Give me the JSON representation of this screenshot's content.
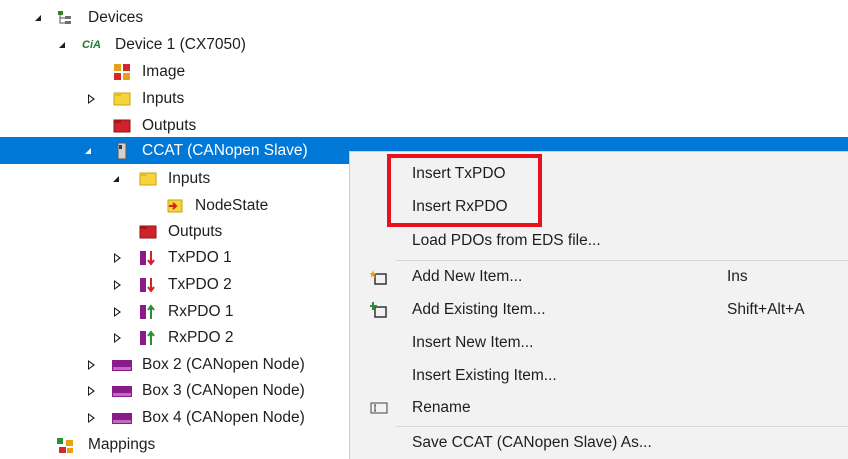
{
  "tree": {
    "devices": "Devices",
    "device1": "Device 1 (CX7050)",
    "cia_badge": "CiA",
    "image": "Image",
    "inputs": "Inputs",
    "outputs": "Outputs",
    "ccat": "CCAT (CANopen Slave)",
    "ccat_inputs": "Inputs",
    "nodestate": "NodeState",
    "ccat_outputs": "Outputs",
    "txpdo1": "TxPDO 1",
    "txpdo2": "TxPDO 2",
    "rxpdo1": "RxPDO 1",
    "rxpdo2": "RxPDO 2",
    "box2": "Box 2 (CANopen Node)",
    "box3": "Box 3 (CANopen Node)",
    "box4": "Box 4 (CANopen Node)",
    "mappings": "Mappings"
  },
  "context_menu": {
    "insert_txpdo": "Insert TxPDO",
    "insert_rxpdo": "Insert RxPDO",
    "load_pdos": "Load PDOs from EDS file...",
    "add_new_item": "Add New Item...",
    "add_new_item_shortcut": "Ins",
    "add_existing_item": "Add Existing Item...",
    "add_existing_item_shortcut": "Shift+Alt+A",
    "insert_new_item": "Insert New Item...",
    "insert_existing_item": "Insert Existing Item...",
    "rename": "Rename",
    "save_as": "Save CCAT (CANopen Slave) As..."
  },
  "colors": {
    "selection": "#0078d7",
    "highlight_box": "#e8121c",
    "menu_bg": "#f2f2f2"
  }
}
